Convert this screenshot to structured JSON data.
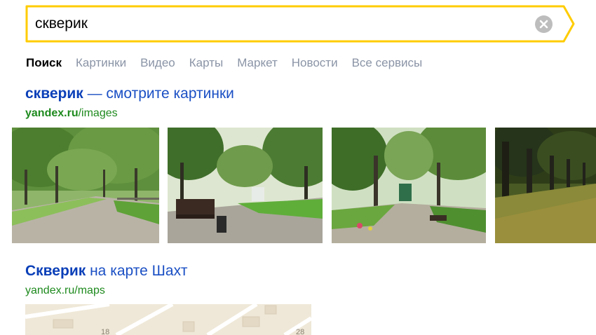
{
  "search": {
    "query": "скверик",
    "accent": "#ffcc00"
  },
  "tabs": [
    {
      "label": "Поиск",
      "active": true
    },
    {
      "label": "Картинки"
    },
    {
      "label": "Видео"
    },
    {
      "label": "Карты"
    },
    {
      "label": "Маркет"
    },
    {
      "label": "Новости"
    },
    {
      "label": "Все сервисы"
    }
  ],
  "results": [
    {
      "title_bold": "скверик",
      "title_rest": " — смотрите картинки",
      "url_bold": "yandex.ru",
      "url_rest": "/images"
    },
    {
      "title_bold": "Скверик",
      "title_rest": " на карте Шахт",
      "url_bold": "",
      "url_rest": "yandex.ru/maps"
    }
  ],
  "map": {
    "labels": [
      "18",
      "28"
    ]
  },
  "colors": {
    "link": "#1a4fc4",
    "url": "#1e8a1e",
    "tab_inactive": "#8a94a6"
  }
}
